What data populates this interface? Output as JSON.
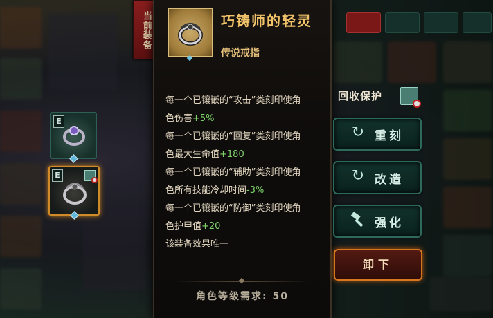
{
  "current_equipment_label": "当前装备",
  "slots": [
    {
      "badge": "E",
      "icon": "ring-icon"
    },
    {
      "badge": "E",
      "icon": "ring-icon",
      "recycle_protected": true
    }
  ],
  "item": {
    "name": "巧铸师的轻灵",
    "type": "传说戒指",
    "icon": "ring-icon",
    "effects": [
      {
        "text": "每一个已镶嵌的“攻击”类刻印使角",
        "value": ""
      },
      {
        "text": "色伤害",
        "value": "+5%"
      },
      {
        "text": "每一个已镶嵌的“回复”类刻印使角",
        "value": ""
      },
      {
        "text": "色最大生命值",
        "value": "+180"
      },
      {
        "text": "每一个已镶嵌的“辅助”类刻印使角",
        "value": ""
      },
      {
        "text": "色所有技能冷却时间",
        "value": "-3%"
      },
      {
        "text": "每一个已镶嵌的“防御”类刻印使角",
        "value": ""
      },
      {
        "text": "色护甲值",
        "value": "+20"
      },
      {
        "text": "该装备效果唯一",
        "value": ""
      }
    ],
    "level_requirement": "角色等级需求: 50"
  },
  "actions": {
    "recycle_protection_label": "回收保护",
    "reforge_label": "重刻",
    "modify_label": "改造",
    "enhance_label": "强化",
    "unequip_label": "卸下"
  },
  "colors": {
    "item_name": "#f0c26a",
    "value_positive": "#7fd36b",
    "unequip_border": "#d6761e"
  }
}
